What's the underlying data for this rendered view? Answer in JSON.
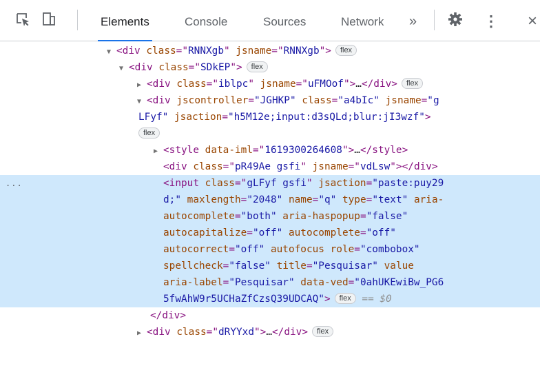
{
  "toolbar": {
    "icons": [
      "inspect-element-icon",
      "device-toolbar-icon",
      "more-tabs-icon",
      "settings-gear-icon",
      "kebab-menu-icon",
      "close-icon"
    ],
    "tabs": [
      {
        "label": "Elements",
        "active": true
      },
      {
        "label": "Console",
        "active": false
      },
      {
        "label": "Sources",
        "active": false
      },
      {
        "label": "Network",
        "active": false
      }
    ],
    "more_tabs": "»",
    "kebab": "⋮",
    "close": "×",
    "accent_color": "#1a73e8"
  },
  "colors": {
    "tag": "#881280",
    "attr_name": "#994500",
    "attr_value": "#1a1aa6",
    "selection_bg": "#cfe8fc"
  },
  "tree": {
    "badge": "flex",
    "selected_marker": "...",
    "selected_eq": "== $0",
    "ellipsis": "…",
    "l1": {
      "tag": "div",
      "class": "RNNXgb",
      "jsname": "RNNXgb"
    },
    "l2": {
      "tag": "div",
      "class": "SDkEP"
    },
    "l3": {
      "tag": "div",
      "class": "iblpc",
      "jsname": "uFMOof"
    },
    "l4": {
      "tag": "div",
      "jscontroller_a": "\"JGHKP\"",
      "class": "\"a4bIc\"",
      "jsname_a": "\"g",
      "jsname_b": "LFyf\"",
      "jsaction": "\"h5M12e;input:d3sQLd;blur:jI3wzf\""
    },
    "l5": {
      "tag": "style",
      "data_iml": "1619300264608"
    },
    "l6": {
      "tag": "div",
      "class": "pR49Ae gsfi",
      "jsname": "vdLsw"
    },
    "input": {
      "class": "gLFyf gsfi",
      "jsaction_a": "\"paste:puy29",
      "jsaction_b": "d;\"",
      "maxlength": "\"2048\"",
      "name": "\"q\"",
      "type": "\"text\"",
      "aria_autocomplete": "\"both\"",
      "aria_haspopup": "\"false\"",
      "autocapitalize": "\"off\"",
      "autocomplete": "\"off\"",
      "autocorrect": "\"off\"",
      "role": "\"combobox\"",
      "spellcheck": "\"false\"",
      "title": "\"Pesquisar\"",
      "aria_label": "\"Pesquisar\"",
      "data_ved_a": "\"0ahUKEwiBw_PG6",
      "data_ved_b": "5fwAhW9r5UCHaZfCzsQ39UDCAQ\""
    },
    "close_div": "div",
    "l7": {
      "tag": "div",
      "class": "dRYYxd"
    }
  }
}
